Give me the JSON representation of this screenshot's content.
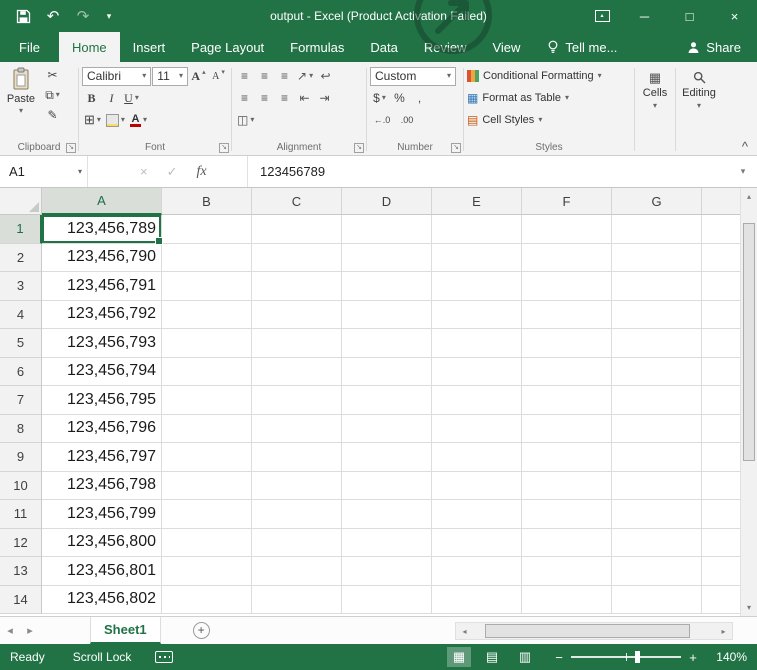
{
  "window": {
    "title": "output - Excel (Product Activation Failed)"
  },
  "menu": {
    "file": "File",
    "tabs": [
      {
        "label": "Home",
        "active": true
      },
      {
        "label": "Insert"
      },
      {
        "label": "Page Layout"
      },
      {
        "label": "Formulas"
      },
      {
        "label": "Data"
      },
      {
        "label": "Review"
      },
      {
        "label": "View"
      }
    ],
    "tell_me": "Tell me...",
    "share": "Share"
  },
  "ribbon": {
    "clipboard": {
      "label": "Clipboard",
      "paste": "Paste"
    },
    "font": {
      "label": "Font",
      "name": "Calibri",
      "size": "11"
    },
    "alignment": {
      "label": "Alignment"
    },
    "number": {
      "label": "Number",
      "format": "Custom",
      "increase_decimal": "←.0",
      "decrease_decimal": ".00"
    },
    "styles": {
      "label": "Styles",
      "conditional_formatting": "Conditional Formatting",
      "format_as_table": "Format as Table",
      "cell_styles": "Cell Styles"
    },
    "cells": {
      "label": "Cells"
    },
    "editing": {
      "label": "Editing"
    }
  },
  "formula_bar": {
    "name_box": "A1",
    "fx": "fx",
    "value": "123456789"
  },
  "grid": {
    "columns": [
      "A",
      "B",
      "C",
      "D",
      "E",
      "F",
      "G"
    ],
    "selection": {
      "active_cell": "A1",
      "column": "A",
      "row": "1"
    },
    "rows": [
      {
        "n": "1",
        "v": "123,456,789"
      },
      {
        "n": "2",
        "v": "123,456,790"
      },
      {
        "n": "3",
        "v": "123,456,791"
      },
      {
        "n": "4",
        "v": "123,456,792"
      },
      {
        "n": "5",
        "v": "123,456,793"
      },
      {
        "n": "6",
        "v": "123,456,794"
      },
      {
        "n": "7",
        "v": "123,456,795"
      },
      {
        "n": "8",
        "v": "123,456,796"
      },
      {
        "n": "9",
        "v": "123,456,797"
      },
      {
        "n": "10",
        "v": "123,456,798"
      },
      {
        "n": "11",
        "v": "123,456,799"
      },
      {
        "n": "12",
        "v": "123,456,800"
      },
      {
        "n": "13",
        "v": "123,456,801"
      },
      {
        "n": "14",
        "v": "123,456,802"
      }
    ]
  },
  "sheet_bar": {
    "active_tab": "Sheet1"
  },
  "status_bar": {
    "mode": "Ready",
    "scroll_lock": "Scroll Lock",
    "zoom_level": "140%"
  },
  "colors": {
    "excel_green": "#217346",
    "font_color_red": "#C00000",
    "fill_yellow": "#FFD966"
  },
  "glyphs": {
    "dd": "▾",
    "undo": "↶",
    "redo": "↷",
    "minimize": "─",
    "maximize": "□",
    "close": "×",
    "cut": "✂",
    "copy": "⧉",
    "format_painter": "✎",
    "bold": "B",
    "italic": "I",
    "underline": "U",
    "letterA": "A",
    "up_small": "▴",
    "down_small": "▾",
    "left_small": "◂",
    "right_small": "▸",
    "borders": "⊞",
    "align_lines": "≡",
    "orientation": "↗",
    "wrap_text": "↩",
    "outdent": "⇤",
    "indent": "⇥",
    "merge": "◫",
    "currency": "$",
    "percent": "%",
    "comma": ",",
    "cells_icon": "▦",
    "launcher": "↘",
    "collapse": "^",
    "cancel": "×",
    "check": "✓",
    "view_normal": "▦",
    "view_layout": "▤",
    "view_break": "▥",
    "minus": "−",
    "plus": "+"
  }
}
